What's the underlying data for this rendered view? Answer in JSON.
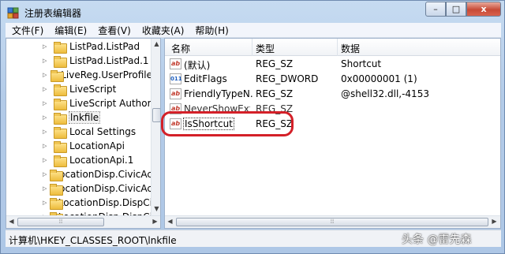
{
  "window": {
    "title": "注册表编辑器",
    "controls": {
      "minimize": "–",
      "maximize": "□",
      "close": "x"
    }
  },
  "menu": [
    "文件(F)",
    "编辑(E)",
    "查看(V)",
    "收藏夹(A)",
    "帮助(H)"
  ],
  "tree": {
    "items": [
      {
        "label": "ListPad.ListPad"
      },
      {
        "label": "ListPad.ListPad.1"
      },
      {
        "label": "LiveReg.UserProfile"
      },
      {
        "label": "LiveScript"
      },
      {
        "label": "LiveScript Author"
      },
      {
        "label": "lnkfile",
        "selected": true
      },
      {
        "label": "Local Settings"
      },
      {
        "label": "LocationApi"
      },
      {
        "label": "LocationApi.1"
      },
      {
        "label": "LocationDisp.CivicAc"
      },
      {
        "label": "LocationDisp.CivicAc"
      },
      {
        "label": "LocationDisp.DispCi"
      },
      {
        "label": "LocationDisp.DispCi"
      }
    ]
  },
  "list": {
    "columns": [
      "名称",
      "类型",
      "数据"
    ],
    "rows": [
      {
        "icon": "string-value-icon",
        "name": "(默认)",
        "type": "REG_SZ",
        "data": "Shortcut"
      },
      {
        "icon": "dword-value-icon",
        "name": "EditFlags",
        "type": "REG_DWORD",
        "data": "0x00000001 (1)"
      },
      {
        "icon": "string-value-icon",
        "name": "FriendlyTypeN...",
        "type": "REG_SZ",
        "data": "@shell32.dll,-4153"
      },
      {
        "icon": "string-value-icon",
        "name": "NeverShowExt",
        "type": "REG_SZ",
        "data": ""
      },
      {
        "icon": "string-value-icon",
        "name": "IsShortcut",
        "type": "REG_SZ",
        "data": ""
      }
    ]
  },
  "highlight_color": "#d42028",
  "status": {
    "path": "计算机\\HKEY_CLASSES_ROOT\\lnkfile"
  },
  "watermark": "头条 @雷先森"
}
